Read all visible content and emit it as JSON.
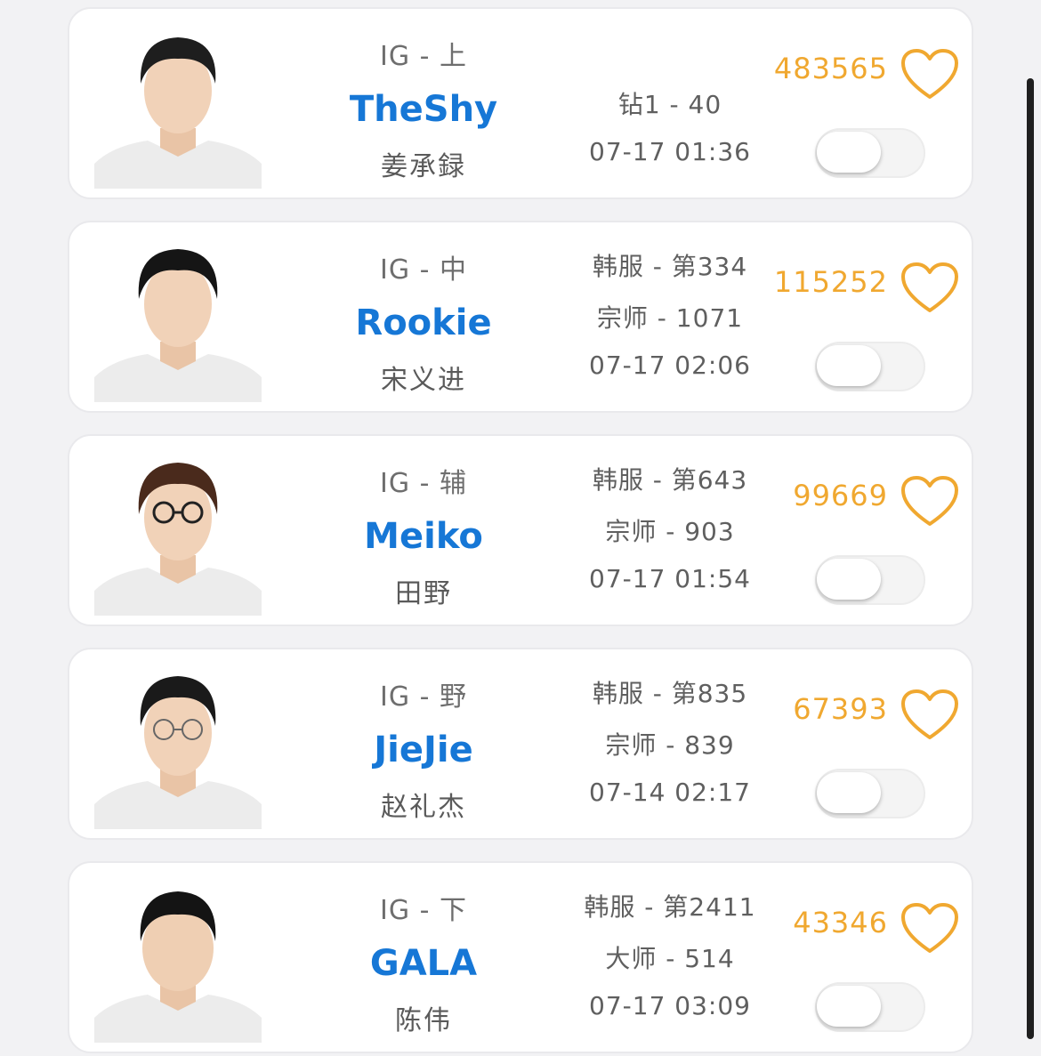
{
  "accent_name_color": "#1677d6",
  "likes_color": "#f0a830",
  "players": [
    {
      "team_pos": "IG - 上",
      "handle": "TheShy",
      "real_name": "姜承録",
      "info": [
        "钻1 - 40",
        "07-17 01:36"
      ],
      "likes": "483565",
      "toggle_on": false
    },
    {
      "team_pos": "IG - 中",
      "handle": "Rookie",
      "real_name": "宋义进",
      "info": [
        "韩服 - 第334",
        "宗师 - 1071",
        "07-17 02:06"
      ],
      "likes": "115252",
      "toggle_on": false
    },
    {
      "team_pos": "IG - 辅",
      "handle": "Meiko",
      "real_name": "田野",
      "info": [
        "韩服 - 第643",
        "宗师 - 903",
        "07-17 01:54"
      ],
      "likes": "99669",
      "toggle_on": false
    },
    {
      "team_pos": "IG - 野",
      "handle": "JieJie",
      "real_name": "赵礼杰",
      "info": [
        "韩服 - 第835",
        "宗师 - 839",
        "07-14 02:17"
      ],
      "likes": "67393",
      "toggle_on": false
    },
    {
      "team_pos": "IG - 下",
      "handle": "GALA",
      "real_name": "陈伟",
      "info": [
        "韩服 - 第2411",
        "大师 - 514",
        "07-17 03:09"
      ],
      "likes": "43346",
      "toggle_on": false
    }
  ]
}
